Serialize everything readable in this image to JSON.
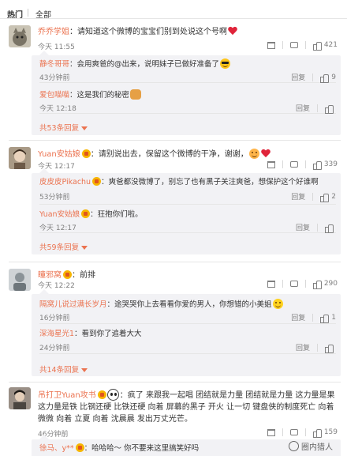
{
  "tabs": [
    "热门",
    "全部"
  ],
  "comments": [
    {
      "user": "乔乔学姐",
      "text": "：请知道这个微博的宝宝们别到处说这个号啊",
      "time": "今天 11:55",
      "likes": "421",
      "avatar_color": "#7a7466",
      "replies": [
        {
          "user": "静冬哥哥",
          "text": "：会用爽爸的@出来，说明妹子已做好准备了",
          "time": "43分钟前",
          "likes": "9"
        },
        {
          "user": "爱包喵喵",
          "text": "：这是我们的秘密",
          "time": "今天 12:18",
          "likes": ""
        }
      ],
      "more": "共53条回复"
    },
    {
      "user": "Yuan安姑娘",
      "text": "：请别说出去，保留这个微博的干净，谢谢，",
      "time": "今天 12:17",
      "likes": "339",
      "avatar_color": "#6d5a48",
      "replies": [
        {
          "user": "皮皮皮Pikachu",
          "text": "：爽爸都没微博了，别忘了也有黑子关注爽爸，想保护这个好谁啊",
          "time": "53分钟前",
          "likes": "2"
        },
        {
          "user": "Yuan安姑娘",
          "text": "：狂抱你们啦。",
          "time": "今天 12:17",
          "likes": ""
        }
      ],
      "more": "共59条回复"
    },
    {
      "user": "瞳邪窝",
      "text": "：前排",
      "time": "今天 12:22",
      "likes": "290",
      "avatar_color": "#8a9297",
      "replies": [
        {
          "user": "隔窝儿说过满长岁月",
          "text": "：途哭哭你上去看看你爱的男人，你想错的小美姐",
          "time": "16分钟前",
          "likes": "1"
        },
        {
          "user": "深海星光1",
          "text": "：看到你了追着大大",
          "time": "24分钟前",
          "likes": ""
        }
      ],
      "more": "共14条回复"
    },
    {
      "user": "吊打卫Yuan攻书",
      "text": "：疯了 来跟我一起唱 团结就是力量 团结就是力量 这力量是果 这力量是铁 比钢还硬 比铁还硬 向着 屏幕的黑子 开火 让一切 键盘侠的制度死亡 向着 微微 向着 立夏 向着 沈晨晨 发出万丈光芒。",
      "time": "46分钟前",
      "likes": "159",
      "avatar_color": "#4a4540",
      "replies": [
        {
          "user": "徐马、y**",
          "text": "：哈哈哈～ 你不要来这里搞笑好吗",
          "time": "",
          "likes": ""
        }
      ],
      "more": ""
    }
  ],
  "actions": {
    "reply": "回复"
  },
  "watermark": "圈内猎人"
}
